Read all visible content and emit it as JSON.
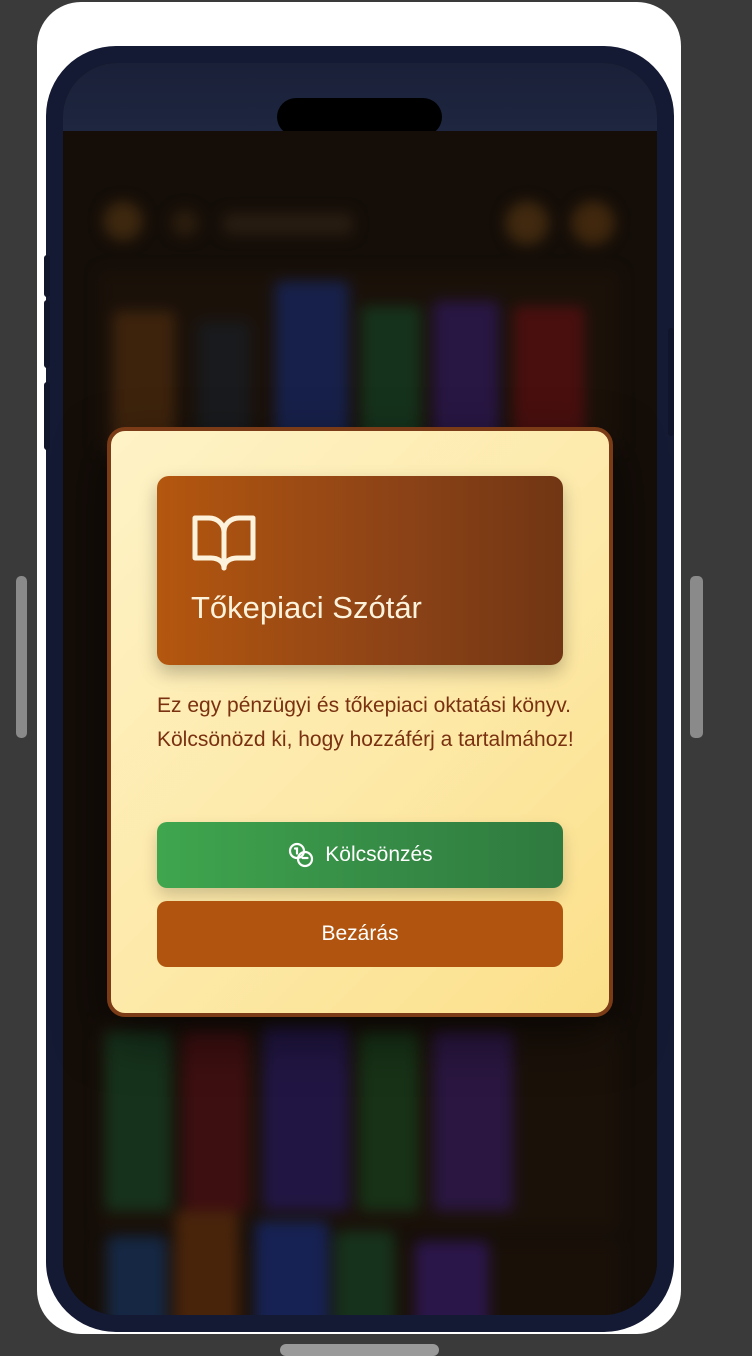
{
  "modal": {
    "title": "Tőkepiaci Szótár",
    "header_icon": "book-open-icon",
    "description": "Ez egy pénzügyi és tőkepiaci oktatási könyv. Kölcsönözd ki, hogy hozzáférj a tartalmához!",
    "borrow_button": {
      "label": "Kölcsönzés",
      "icon": "coins-icon",
      "color": "#3fa64e"
    },
    "close_button": {
      "label": "Bezárás",
      "color": "#b0540f"
    },
    "border_color": "#7a3b16",
    "header_color": "#b4570f",
    "text_color": "#7a3110"
  }
}
